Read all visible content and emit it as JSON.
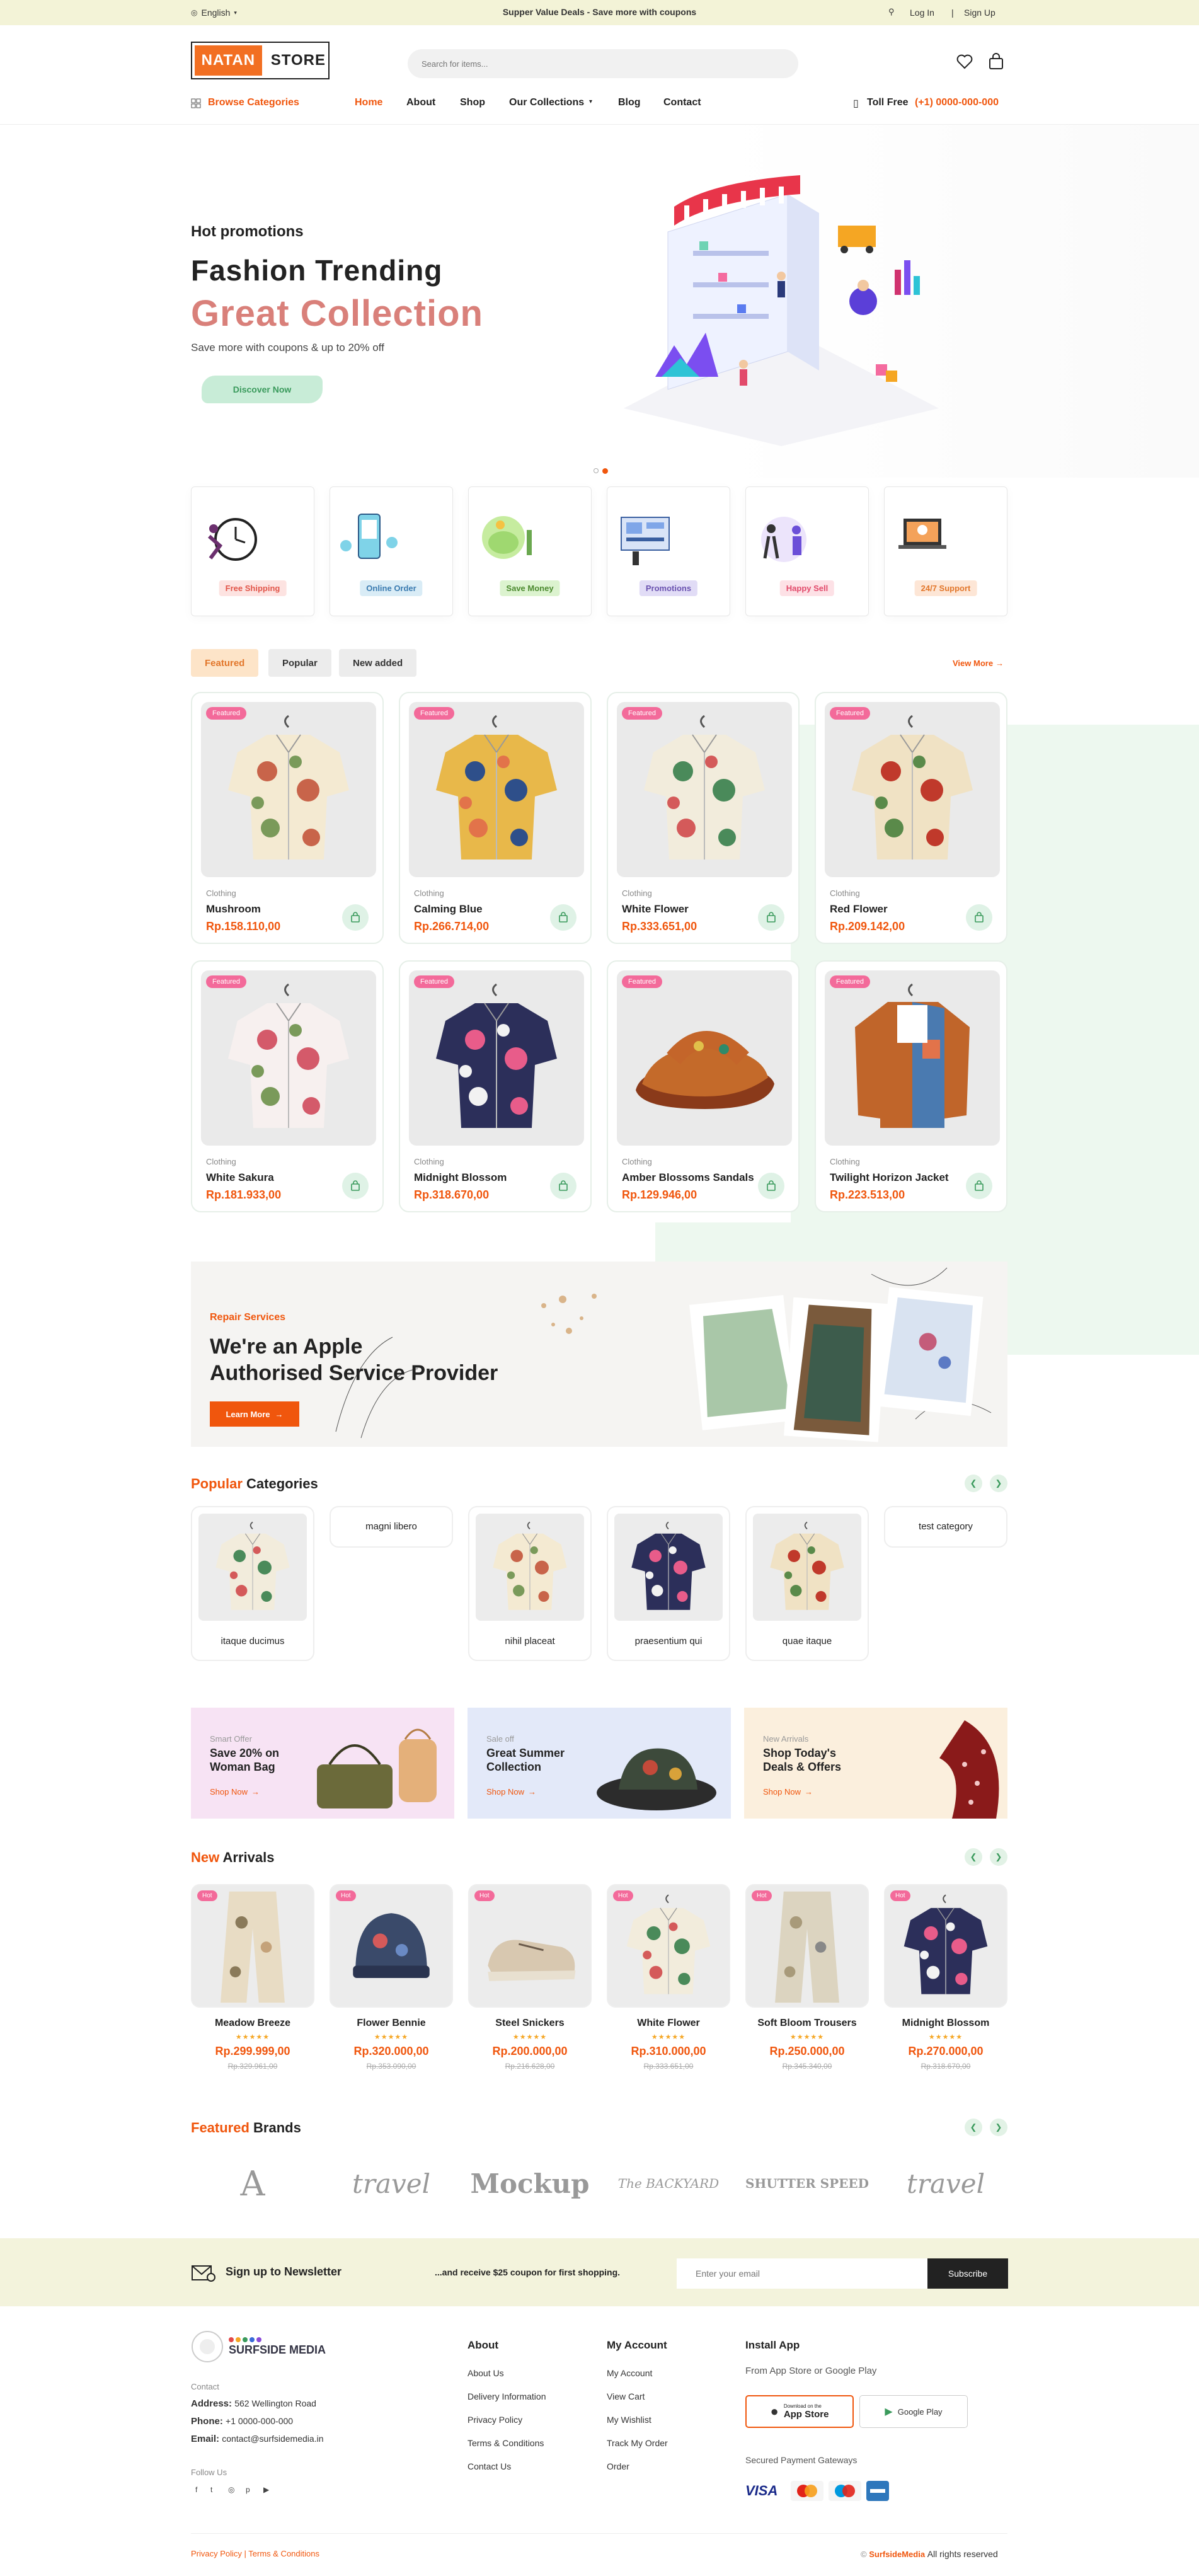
{
  "topbar": {
    "language": "English",
    "promo": "Supper Value Deals - Save more with coupons",
    "login": "Log In",
    "signup": "Sign Up"
  },
  "header": {
    "logo_left": "NATAN",
    "logo_right": "STORE",
    "search_placeholder": "Search for items..."
  },
  "nav": {
    "browse": "Browse Categories",
    "items": [
      "Home",
      "About",
      "Shop",
      "Our Collections",
      "Blog",
      "Contact"
    ],
    "toll_label": "Toll Free",
    "toll_number": "(+1) 0000-000-000"
  },
  "hero": {
    "kicker": "Hot promotions",
    "title": "Fashion Trending",
    "title2": "Great Collection",
    "subtitle": "Save more with coupons & up to 20% off",
    "cta": "Discover Now"
  },
  "services": [
    "Free Shipping",
    "Online Order",
    "Save Money",
    "Promotions",
    "Happy Sell",
    "24/7 Support"
  ],
  "tabs": {
    "featured": "Featured",
    "popular": "Popular",
    "new": "New added",
    "view_more": "View More"
  },
  "products": [
    {
      "badge": "Featured",
      "cat": "Clothing",
      "name": "Mushroom",
      "price": "Rp.158.110,00"
    },
    {
      "badge": "Featured",
      "cat": "Clothing",
      "name": "Calming Blue",
      "price": "Rp.266.714,00"
    },
    {
      "badge": "Featured",
      "cat": "Clothing",
      "name": "White Flower",
      "price": "Rp.333.651,00"
    },
    {
      "badge": "Featured",
      "cat": "Clothing",
      "name": "Red Flower",
      "price": "Rp.209.142,00"
    },
    {
      "badge": "Featured",
      "cat": "Clothing",
      "name": "White Sakura",
      "price": "Rp.181.933,00"
    },
    {
      "badge": "Featured",
      "cat": "Clothing",
      "name": "Midnight Blossom",
      "price": "Rp.318.670,00"
    },
    {
      "badge": "Featured",
      "cat": "Clothing",
      "name": "Amber Blossoms Sandals",
      "price": "Rp.129.946,00"
    },
    {
      "badge": "Featured",
      "cat": "Clothing",
      "name": "Twilight Horizon Jacket",
      "price": "Rp.223.513,00"
    }
  ],
  "repair": {
    "kicker": "Repair Services",
    "title1": "We're an Apple",
    "title2": "Authorised Service Provider",
    "cta": "Learn More"
  },
  "popular": {
    "title_a": "Popular",
    "title_b": "Categories",
    "items": [
      "itaque ducimus",
      "magni libero",
      "nihil placeat",
      "praesentium qui",
      "quae itaque",
      "test category"
    ]
  },
  "banners": [
    {
      "kicker": "Smart Offer",
      "title1": "Save 20% on",
      "title2": "Woman Bag",
      "cta": "Shop Now"
    },
    {
      "kicker": "Sale off",
      "title1": "Great Summer",
      "title2": "Collection",
      "cta": "Shop Now"
    },
    {
      "kicker": "New Arrivals",
      "title1": "Shop Today's",
      "title2": "Deals & Offers",
      "cta": "Shop Now"
    }
  ],
  "arrivals": {
    "title_a": "New",
    "title_b": "Arrivals",
    "items": [
      {
        "badge": "Hot",
        "name": "Meadow Breeze",
        "price": "Rp.299.999,00",
        "old": "Rp.329.961,00"
      },
      {
        "badge": "Hot",
        "name": "Flower Bennie",
        "price": "Rp.320.000,00",
        "old": "Rp.353.090,00"
      },
      {
        "badge": "Hot",
        "name": "Steel Snickers",
        "price": "Rp.200.000,00",
        "old": "Rp.216.628,00"
      },
      {
        "badge": "Hot",
        "name": "White Flower",
        "price": "Rp.310.000,00",
        "old": "Rp.333.651,00"
      },
      {
        "badge": "Hot",
        "name": "Soft Bloom Trousers",
        "price": "Rp.250.000,00",
        "old": "Rp.345.340,00"
      },
      {
        "badge": "Hot",
        "name": "Midnight Blossom",
        "price": "Rp.270.000,00",
        "old": "Rp.318.670,00"
      }
    ]
  },
  "brands": {
    "title_a": "Featured",
    "title_b": "Brands",
    "items": [
      "A",
      "travel",
      "Mockup",
      "The BACKYARD",
      "SHUTTER SPEED",
      "travel"
    ]
  },
  "newsletter": {
    "title": "Sign up to Newsletter",
    "text": "...and receive $25 coupon for first shopping.",
    "placeholder": "Enter your email",
    "button": "Subscribe"
  },
  "footer": {
    "logo": "SURFSIDE MEDIA",
    "contact_label": "Contact",
    "address_label": "Address:",
    "address": "562 Wellington Road",
    "phone_label": "Phone:",
    "phone": "+1 0000-000-000",
    "email_label": "Email:",
    "email": "contact@surfsidemedia.in",
    "follow": "Follow Us",
    "about_title": "About",
    "about": [
      "About Us",
      "Delivery Information",
      "Privacy Policy",
      "Terms & Conditions",
      "Contact Us"
    ],
    "account_title": "My Account",
    "account": [
      "My Account",
      "View Cart",
      "My Wishlist",
      "Track My Order",
      "Order"
    ],
    "app_title": "Install App",
    "app_sub": "From App Store or Google Play",
    "appstore_small": "Download on the",
    "appstore": "App Store",
    "googleplay": "Google Play",
    "payment": "Secured Payment Gateways",
    "pay": [
      "VISA",
      "MC",
      "Maestro",
      "AMEX"
    ],
    "bottom_left": "Privacy Policy | Terms & Conditions",
    "copy_brand": "SurfsideMedia",
    "copy_rest": "All rights reserved"
  },
  "colors": {
    "accent": "#f0560d",
    "green": "#3a9a5c",
    "topbar": "#f3f3d7"
  }
}
